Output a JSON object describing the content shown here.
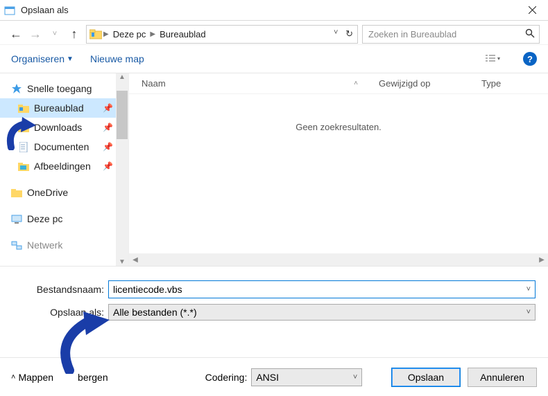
{
  "window": {
    "title": "Opslaan als"
  },
  "breadcrumb": {
    "root": "Deze pc",
    "leaf": "Bureaublad"
  },
  "search": {
    "placeholder": "Zoeken in Bureaublad"
  },
  "toolbar": {
    "organize": "Organiseren",
    "newfolder": "Nieuwe map"
  },
  "columns": {
    "name": "Naam",
    "modified": "Gewijzigd op",
    "type": "Type"
  },
  "content": {
    "empty": "Geen zoekresultaten."
  },
  "sidebar": {
    "quick": "Snelle toegang",
    "desktop": "Bureaublad",
    "downloads": "Downloads",
    "documents": "Documenten",
    "pictures": "Afbeeldingen",
    "onedrive": "OneDrive",
    "thispc": "Deze pc",
    "network": "Netwerk"
  },
  "form": {
    "filename_label": "Bestandsnaam:",
    "filename_value": "licentiecode.vbs",
    "saveas_label": "Opslaan als:",
    "saveas_value": "Alle bestanden  (*.*)"
  },
  "footer": {
    "hide": "Mappen         bergen",
    "encoding_label": "Codering:",
    "encoding_value": "ANSI",
    "save": "Opslaan",
    "cancel": "Annuleren"
  }
}
